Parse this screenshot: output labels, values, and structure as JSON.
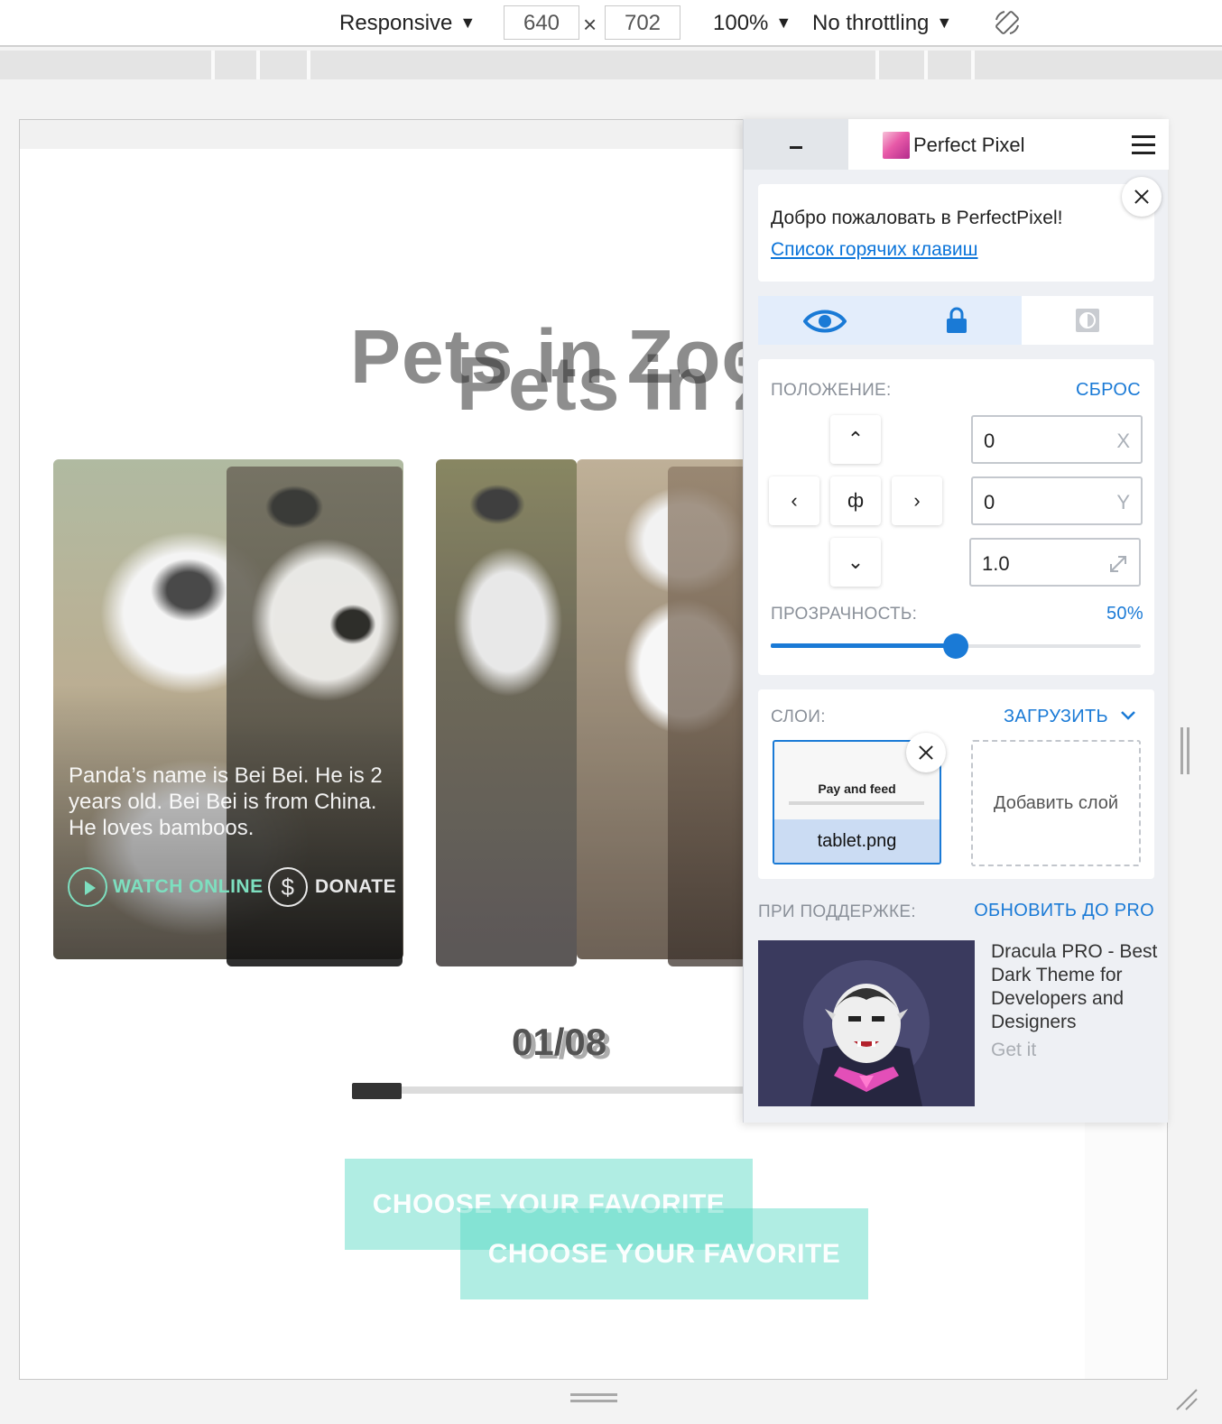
{
  "devtools": {
    "device": "Responsive",
    "width": "640",
    "height": "702",
    "times": "×",
    "zoom": "100%",
    "throttling": "No throttling",
    "caret": "▼"
  },
  "page": {
    "title_a": "Pets in Zoo",
    "title_b": "Pets in Zoo",
    "panda_text": "Panda’s name is Bei Bei. He is 2 years old. Bei Bei is from China. He loves bamboos.",
    "watch_label": "WATCH ONLINE",
    "donate_label": "DONATE",
    "dollar": "$",
    "counter_a": "01/08",
    "counter_b": "01/08",
    "progress": 0.125,
    "cta_a": "CHOOSE YOUR FAVORITE",
    "cta_b": "CHOOSE YOUR FAVORITE",
    "accent": "#50d6c2"
  },
  "perfectpixel": {
    "title": "Perfect Pixel",
    "welcome": "Добро пожаловать в PerfectPixel!",
    "hotkeys_link": "Список горячих клавиш",
    "position_label": "ПОЛОЖЕНИЕ:",
    "reset_label": "СБРОС",
    "up": "⌃",
    "left": "‹",
    "center": "ф",
    "right": "›",
    "down": "⌄",
    "x_value": "0",
    "x_unit": "X",
    "y_value": "0",
    "y_unit": "Y",
    "scale_value": "1.0",
    "opacity_label": "ПРОЗРАЧНОСТЬ:",
    "opacity_value": "50%",
    "opacity": 0.5,
    "layers_label": "СЛОИ:",
    "upload_label": "ЗАГРУЗИТЬ",
    "layer_preview_title": "Pay and feed",
    "layer_name": "tablet.png",
    "add_layer": "Добавить слой",
    "sponsor_label": "ПРИ ПОДДЕРЖКЕ:",
    "upgrade_label": "ОБНОВИТЬ ДО PRO",
    "ad_text": "Dracula PRO - Best Dark Theme for Developers and Designers",
    "ad_get": "Get it",
    "accent": "#1a7ad6"
  }
}
